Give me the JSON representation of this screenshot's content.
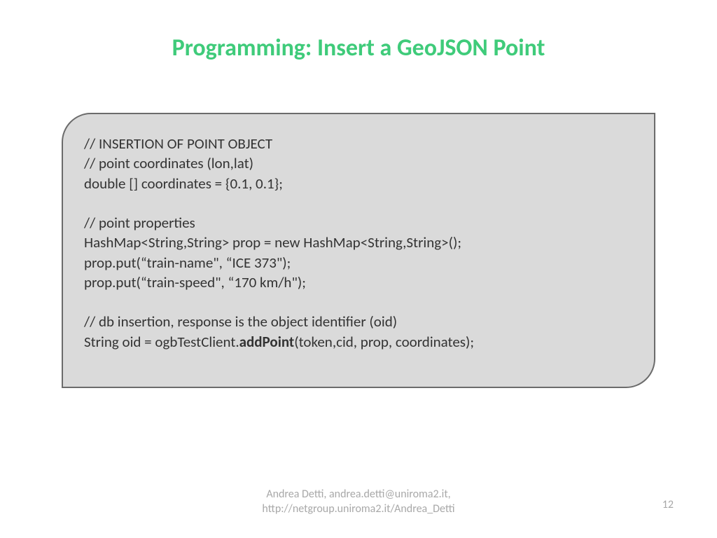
{
  "title": "Programming: Insert a GeoJSON Point",
  "code": {
    "line1": "// INSERTION OF POINT OBJECT",
    "line2": "// point coordinates (lon,lat)",
    "line3": "double [] coordinates =  {0.1, 0.1};",
    "line4": "// point properties",
    "line5": "HashMap<String,String> prop = new HashMap<String,String>();",
    "line6": "prop.put(“train-name\", “ICE 373\");",
    "line7": "prop.put(“train-speed\", “170 km/h\");",
    "line8": "// db insertion, response is the object identifier (oid)",
    "line9_part1": "String oid = ogbTestClient.",
    "line9_bold": "addPoint",
    "line9_part2": "(token,cid, prop, coordinates);"
  },
  "footer": {
    "line1": "Andrea Detti, andrea.detti@uniroma2.it,",
    "line2": "http://netgroup.uniroma2.it/Andrea_Detti"
  },
  "pageNumber": "12"
}
